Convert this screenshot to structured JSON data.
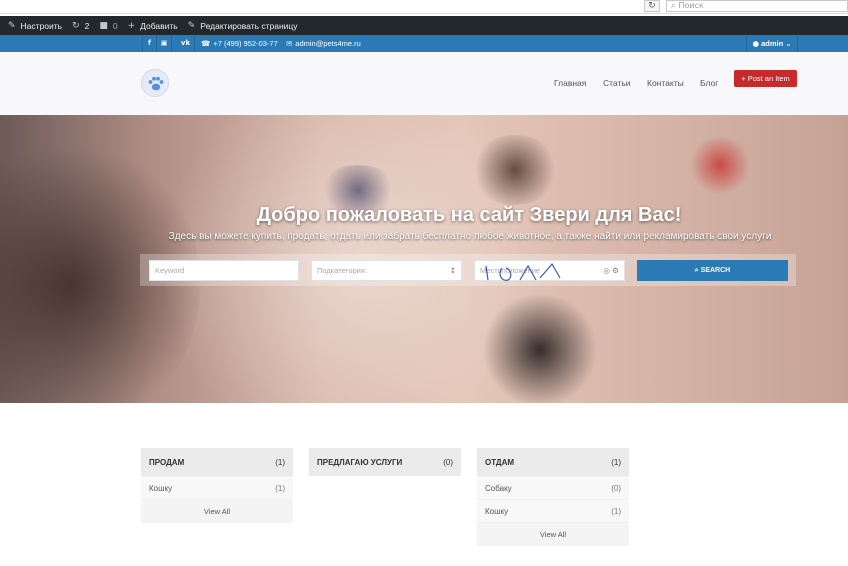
{
  "browser": {
    "refresh_icon": "refresh-icon",
    "search_placeholder": "Поиск"
  },
  "adminbar": {
    "customize": "Настроить",
    "updates_count": "2",
    "comments_count": "0",
    "add_new": "Добавить",
    "edit_page": "Редактировать страницу"
  },
  "topbar": {
    "social": [
      "f",
      "ig",
      "vk"
    ],
    "phone": "+7 (499) 952-03-77",
    "email": "admin@pets4me.ru",
    "user": "admin"
  },
  "header": {
    "nav": [
      "Главная",
      "Статьи",
      "Контакты",
      "Блог"
    ],
    "post_button": "Post an Item"
  },
  "hero": {
    "title": "Добро пожаловать на сайт Звери для Вас!",
    "subtitle": "Здесь вы можете купить, продать, отдать или забрать бесплатно любое животное, а также найти или рекламировать свои услуги",
    "keyword_placeholder": "Keyword",
    "subcategory_placeholder": "Подкатегория:",
    "location_placeholder": "Местоположение",
    "search_button": "SEARCH"
  },
  "categories": [
    {
      "name": "ПРОДАМ",
      "count": "(1)",
      "items": [
        {
          "name": "Кошку",
          "count": "(1)"
        }
      ],
      "view_all": "View All"
    },
    {
      "name": "ПРЕДЛАГАЮ УСЛУГИ",
      "count": "(0)",
      "items": [],
      "view_all": ""
    },
    {
      "name": "ОТДАМ",
      "count": "(1)",
      "items": [
        {
          "name": "Собаку",
          "count": "(0)"
        },
        {
          "name": "Кошку",
          "count": "(1)"
        }
      ],
      "view_all": "View All"
    }
  ],
  "colors": {
    "accent": "#2b7ab6",
    "adminbar": "#23282d",
    "post_button": "#c62a2a"
  }
}
